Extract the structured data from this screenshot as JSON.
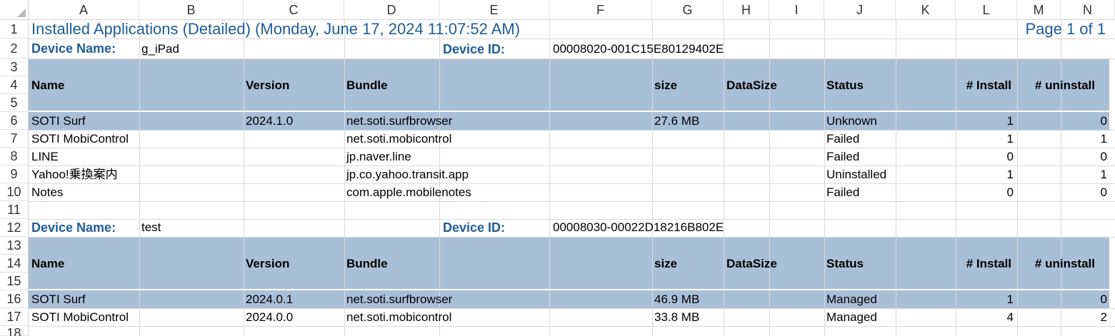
{
  "columns": [
    "A",
    "B",
    "C",
    "D",
    "E",
    "F",
    "G",
    "H",
    "I",
    "J",
    "K",
    "L",
    "M",
    "N"
  ],
  "rows": [
    "1",
    "2",
    "3",
    "4",
    "5",
    "6",
    "7",
    "8",
    "9",
    "10",
    "11",
    "12",
    "13",
    "14",
    "15",
    "16",
    "17",
    "18"
  ],
  "report": {
    "title": "Installed Applications (Detailed)  (Monday, June 17, 2024 11:07:52 AM)",
    "page": "Page 1 of 1"
  },
  "headers": {
    "name": "Name",
    "version": "Version",
    "bundle": "Bundle",
    "size": "size",
    "datasize": "DataSize",
    "status": "Status",
    "install": "#  Install",
    "uninstall": "# uninstall"
  },
  "devices": [
    {
      "name_label": "Device Name:",
      "name": "g_iPad",
      "id_label": "Device ID:",
      "id": "00008020-001C15E80129402E",
      "apps": [
        {
          "name": "SOTI Surf",
          "version": "2024.1.0",
          "bundle": "net.soti.surfbrowser",
          "size": "27.6 MB",
          "status": "Unknown",
          "install": "1",
          "uninstall": "0"
        },
        {
          "name": "SOTI MobiControl",
          "version": "",
          "bundle": "net.soti.mobicontrol",
          "size": "",
          "status": "Failed",
          "install": "1",
          "uninstall": "1"
        },
        {
          "name": "LINE",
          "version": "",
          "bundle": "jp.naver.line",
          "size": "",
          "status": "Failed",
          "install": "0",
          "uninstall": "0"
        },
        {
          "name": "Yahoo!乗換案内",
          "version": "",
          "bundle": "jp.co.yahoo.transit.app",
          "size": "",
          "status": "Uninstalled",
          "install": "1",
          "uninstall": "1"
        },
        {
          "name": "Notes",
          "version": "",
          "bundle": "com.apple.mobilenotes",
          "size": "",
          "status": "Failed",
          "install": "0",
          "uninstall": "0"
        }
      ]
    },
    {
      "name_label": "Device Name:",
      "name": "test",
      "id_label": "Device ID:",
      "id": "00008030-00022D18216B802E",
      "apps": [
        {
          "name": "SOTI Surf",
          "version": "2024.0.1",
          "bundle": "net.soti.surfbrowser",
          "size": "46.9 MB",
          "status": "Managed",
          "install": "1",
          "uninstall": "0"
        },
        {
          "name": "SOTI MobiControl",
          "version": "2024.0.0",
          "bundle": "net.soti.mobicontrol",
          "size": "33.8 MB",
          "status": "Managed",
          "install": "4",
          "uninstall": "2"
        }
      ]
    }
  ],
  "colors": {
    "header_band": "#a9bfd6",
    "title_blue": "#1f5c99"
  }
}
